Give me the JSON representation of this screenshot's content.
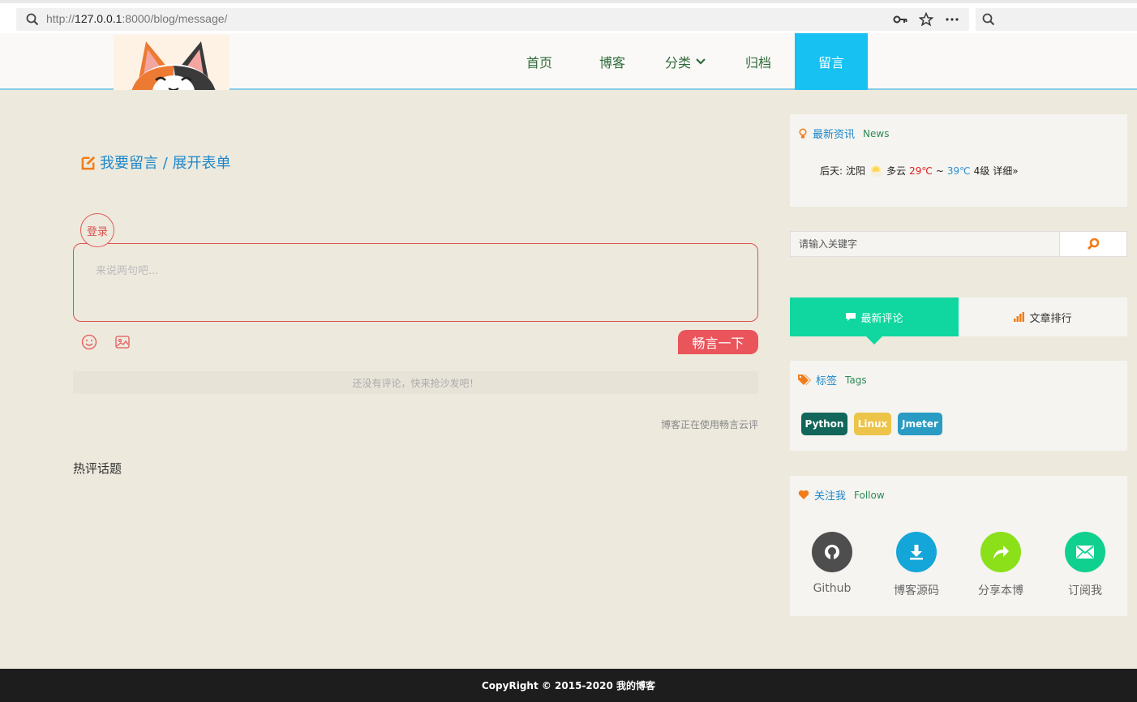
{
  "browser": {
    "url_prefix": "http://",
    "url_host": "127.0.0.1",
    "url_rest": ":8000/blog/message/",
    "icons": [
      "key-icon",
      "star-icon",
      "more-icon",
      "search-icon"
    ]
  },
  "nav": {
    "items": [
      {
        "label": "首页"
      },
      {
        "label": "博客"
      },
      {
        "label": "分类"
      },
      {
        "label": "归档"
      },
      {
        "label": "留言"
      }
    ],
    "active_color": "#17c1f2"
  },
  "message": {
    "header_text": "我要留言 / 展开表单",
    "login_badge": "登录",
    "placeholder": "来说两句吧...",
    "submit_label": "畅言一下",
    "empty_tip": "还没有评论，快来抢沙发吧！",
    "powered_by": "博客正在使用畅言云评",
    "hot_topics": "热评话题"
  },
  "sidebar": {
    "news": {
      "title": "最新资讯",
      "subtitle": "News",
      "weather_day": "后天:",
      "city": "沈阳",
      "condition": "多云",
      "high": "29℃",
      "sep": "~",
      "low": "39℃",
      "wind": "4级",
      "detail": "详细»"
    },
    "search": {
      "placeholder": "请输入关键字"
    },
    "tabs": [
      {
        "label": "最新评论"
      },
      {
        "label": "文章排行"
      }
    ],
    "tags": {
      "title": "标签",
      "subtitle": "Tags",
      "items": [
        {
          "label": "Python",
          "color": "#12675a"
        },
        {
          "label": "Linux",
          "color": "#ecc449"
        },
        {
          "label": "Jmeter",
          "color": "#2a9bc3"
        }
      ]
    },
    "follow": {
      "title": "关注我",
      "subtitle": "Follow",
      "items": [
        {
          "label": "Github",
          "color": "#4e4e4e"
        },
        {
          "label": "博客源码",
          "color": "#14a6d8"
        },
        {
          "label": "分享本博",
          "color": "#8be01a"
        },
        {
          "label": "订阅我",
          "color": "#10d08f"
        }
      ]
    }
  },
  "footer": {
    "text": "CopyRight © 2015-2020 我的博客"
  }
}
